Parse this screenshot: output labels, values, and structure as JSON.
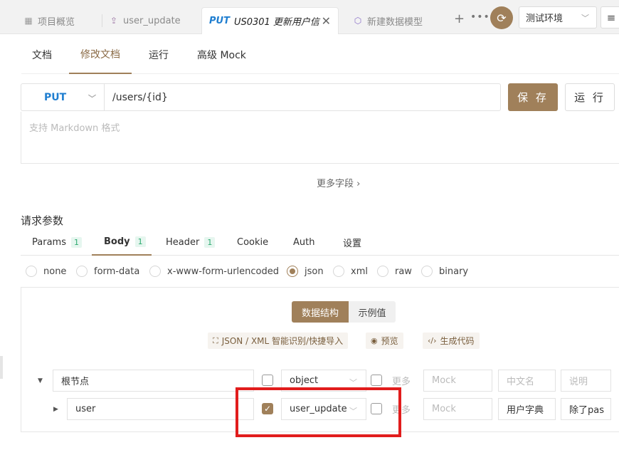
{
  "tabs": [
    {
      "icon": "grid-icon",
      "title": "项目概览"
    },
    {
      "icon": "export-icon",
      "title": "user_update"
    },
    {
      "method": "PUT",
      "title": "US0301 更新用户信",
      "active": true
    },
    {
      "icon": "cube-icon",
      "title": "新建数据模型"
    }
  ],
  "toolbar": {
    "plus": "+",
    "more": "•••",
    "sync_icon": "⟳",
    "env": "测试环境",
    "menu": "≡"
  },
  "subtabs": [
    "文档",
    "修改文档",
    "运行",
    "高级 Mock"
  ],
  "request": {
    "method": "PUT",
    "url": "/users/{id}",
    "save_label": "保 存",
    "run_label": "运 行",
    "desc_placeholder": "支持 Markdown 格式",
    "more_fields": "更多字段 ›"
  },
  "section_title": "请求参数",
  "param_tabs": [
    {
      "label": "Params",
      "badge": "1"
    },
    {
      "label": "Body",
      "badge": "1"
    },
    {
      "label": "Header",
      "badge": "1"
    },
    {
      "label": "Cookie",
      "badge": ""
    },
    {
      "label": "Auth",
      "badge": ""
    },
    {
      "label": "设置",
      "badge": ""
    }
  ],
  "body_types": [
    "none",
    "form-data",
    "x-www-form-urlencoded",
    "json",
    "xml",
    "raw",
    "binary"
  ],
  "selected_body_type": "json",
  "view_toggle": {
    "structure": "数据结构",
    "example": "示例值"
  },
  "tools": [
    "JSON / XML 智能识别/快捷导入",
    "预览",
    "生成代码"
  ],
  "rows": [
    {
      "name": "根节点",
      "type": "object",
      "more": "更多",
      "mock": "Mock",
      "cn_name": "中文名",
      "desc": "说明"
    },
    {
      "name": "user",
      "type": "user_update",
      "more": "更多",
      "mock": "Mock",
      "cn_name": "用户字典",
      "desc": "除了pas"
    }
  ],
  "colors": {
    "accent": "#a0805a",
    "put": "#1f7ed0",
    "highlight": "#e11d1d"
  }
}
